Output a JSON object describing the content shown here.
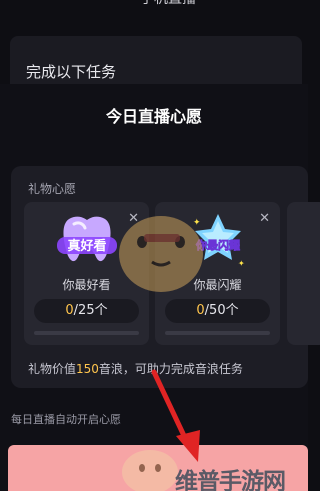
{
  "header": {
    "top_fragment": "手机直播",
    "task_title": "完成以下任务"
  },
  "sheet": {
    "title": "今日直播心愿"
  },
  "gift_panel": {
    "label": "礼物心愿",
    "cards": [
      {
        "name": "你最好看",
        "current": "0",
        "total": "/25个",
        "icon": "tooth-gift-icon",
        "sticker_text": "真好看",
        "progress_fraction": 0
      },
      {
        "name": "你最闪耀",
        "current": "0",
        "total": "/50个",
        "icon": "star-gift-icon",
        "sticker_text": "你最闪耀",
        "progress_fraction": 0
      }
    ],
    "note": {
      "prefix": "礼物价值",
      "amount": "150",
      "suffix": "音浪，可助力完成音浪任务"
    }
  },
  "auto_wish": {
    "label": "每日直播自动开启心愿"
  },
  "watermark": {
    "text": "维普手游网"
  },
  "colors": {
    "accent": "#ffc54d",
    "panel": "#1d1d25",
    "card": "#272730",
    "button": "#f6a4a5",
    "arrow": "#e02424"
  }
}
